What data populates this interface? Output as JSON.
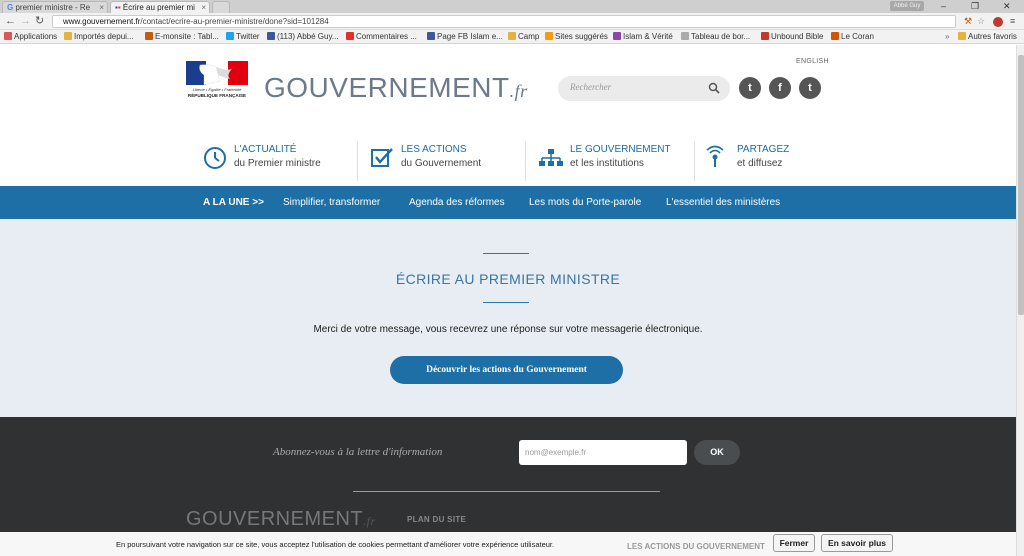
{
  "browser": {
    "tabs": [
      {
        "label": "premier ministre - Re"
      },
      {
        "label": "Écrire au premier mi"
      }
    ],
    "user_badge": "Abbé Guy",
    "url_host": "www.gouvernement.fr",
    "url_path": "/contact/ecrire-au-premier-ministre/done?sid=101284",
    "bookmarks": [
      {
        "label": "Applications",
        "color": "#d55"
      },
      {
        "label": "Importés depui...",
        "color": "#e3b341"
      },
      {
        "label": "E-monsite : Tabl...",
        "color": "#c55a11"
      },
      {
        "label": "Twitter",
        "color": "#1da1f2"
      },
      {
        "label": "(113) Abbé Guy...",
        "color": "#3b5998"
      },
      {
        "label": "Commentaires ...",
        "color": "#e52d27"
      },
      {
        "label": "Page FB Islam e...",
        "color": "#3b5998"
      },
      {
        "label": "Camp",
        "color": "#e3b341"
      },
      {
        "label": "Sites suggérés",
        "color": "#f39c12"
      },
      {
        "label": "Islam & Vérité",
        "color": "#8e44ad"
      },
      {
        "label": "Tableau de bor...",
        "color": "#aaa"
      },
      {
        "label": "Unbound Bible",
        "color": "#c0392b"
      },
      {
        "label": "Le Coran",
        "color": "#d35400"
      }
    ],
    "other_bookmarks": "Autres favoris"
  },
  "header": {
    "motto": "Liberté • Égalité • Fraternité",
    "republic": "RÉPUBLIQUE FRANÇAISE",
    "brand_main": "GOUVERNEMENT",
    "brand_suffix": ".fr",
    "search_placeholder": "Rechercher",
    "english_link": "ENGLISH",
    "social": [
      {
        "label": "twitter",
        "glyph": "t"
      },
      {
        "label": "facebook",
        "glyph": "f"
      },
      {
        "label": "tumblr",
        "glyph": "t"
      }
    ]
  },
  "main_menu": [
    {
      "line1": "L'ACTUALITÉ",
      "line2": "du Premier ministre",
      "icon": "clock-icon"
    },
    {
      "line1": "LES ACTIONS",
      "line2": "du Gouvernement",
      "icon": "checkbox-icon"
    },
    {
      "line1": "LE GOUVERNEMENT",
      "line2": "et les institutions",
      "icon": "org-chart-icon"
    },
    {
      "line1": "PARTAGEZ",
      "line2": "et diffusez",
      "icon": "broadcast-icon"
    }
  ],
  "bluebar": {
    "lead": "A LA UNE >>",
    "items": [
      "Simplifier, transformer",
      "Agenda des réformes",
      "Les mots du Porte-parole",
      "L'essentiel des ministères"
    ]
  },
  "confirmation": {
    "title": "ÉCRIRE AU PREMIER MINISTRE",
    "message": "Merci de votre message, vous recevrez une réponse sur votre messagerie électronique.",
    "cta_label": "Découvrir les actions du Gouvernement"
  },
  "footer": {
    "newsletter_label": "Abonnez-vous à la lettre d'information",
    "newsletter_placeholder": "nom@exemple.fr",
    "newsletter_ok": "OK",
    "logo_main": "GOUVERNEMENT",
    "logo_suffix": ".fr",
    "plan_title": "PLAN DU SITE",
    "actions_heading": "LES ACTIONS DU GOUVERNEMENT"
  },
  "cookie_banner": {
    "message": "En poursuivant votre navigation sur ce site, vous acceptez l'utilisation de cookies permettant d'améliorer votre expérience utilisateur.",
    "close_label": "Fermer",
    "more_label": "En savoir plus"
  },
  "colors": {
    "primary_blue": "#1d6fa5",
    "grey_zone": "#e7edf2",
    "footer_dark": "#2f3133"
  }
}
